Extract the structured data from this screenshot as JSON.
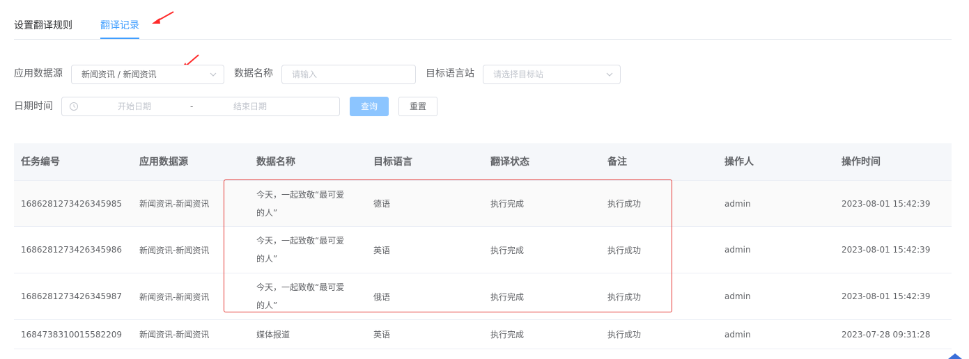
{
  "tabs": [
    {
      "label": "设置翻译规则",
      "active": false
    },
    {
      "label": "翻译记录",
      "active": true
    }
  ],
  "filters": {
    "source_label": "应用数据源",
    "source_value": "新闻资讯 / 新闻资讯",
    "name_label": "数据名称",
    "name_placeholder": "请输入",
    "target_label": "目标语言站",
    "target_placeholder": "请选择目标站",
    "date_label": "日期时间",
    "date_start_placeholder": "开始日期",
    "date_separator": "-",
    "date_end_placeholder": "结束日期",
    "query_button": "查询",
    "reset_button": "重置"
  },
  "table": {
    "headers": [
      "任务编号",
      "应用数据源",
      "数据名称",
      "目标语言",
      "翻译状态",
      "备注",
      "操作人",
      "操作时间"
    ],
    "rows": [
      [
        "1686281273426345985",
        "新闻资讯-新闻资讯",
        "今天，一起致敬“最可爱的人”",
        "德语",
        "执行完成",
        "执行成功",
        "admin",
        "2023-08-01 15:42:39"
      ],
      [
        "1686281273426345986",
        "新闻资讯-新闻资讯",
        "今天，一起致敬“最可爱的人”",
        "英语",
        "执行完成",
        "执行成功",
        "admin",
        "2023-08-01 15:42:39"
      ],
      [
        "1686281273426345987",
        "新闻资讯-新闻资讯",
        "今天，一起致敬“最可爱的人”",
        "俄语",
        "执行完成",
        "执行成功",
        "admin",
        "2023-08-01 15:42:39"
      ],
      [
        "1684738310015582209",
        "新闻资讯-新闻资讯",
        "媒体报道",
        "英语",
        "执行完成",
        "执行成功",
        "admin",
        "2023-07-28 09:31:28"
      ]
    ]
  },
  "colors": {
    "accent": "#409eff",
    "annotation": "#e53935"
  }
}
